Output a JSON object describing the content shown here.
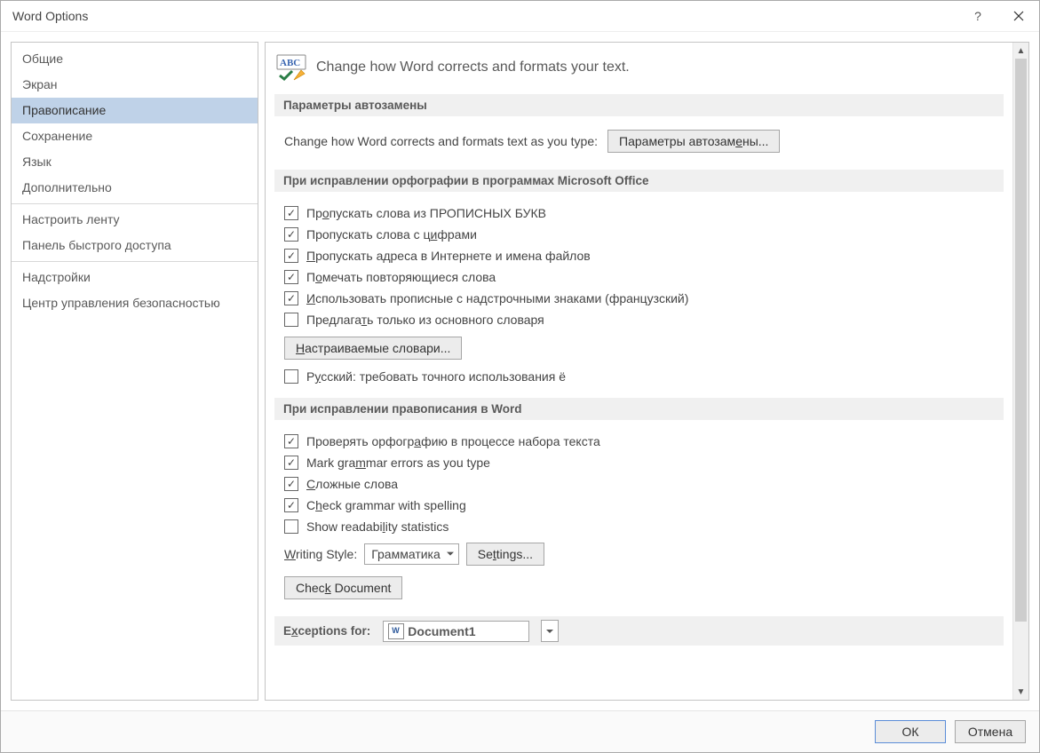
{
  "window": {
    "title": "Word Options"
  },
  "sidebar": {
    "items": [
      {
        "label": "Общие"
      },
      {
        "label": "Экран"
      },
      {
        "label": "Правописание",
        "selected": true
      },
      {
        "label": "Сохранение"
      },
      {
        "label": "Язык"
      },
      {
        "label": "Дополнительно"
      }
    ],
    "items2": [
      {
        "label": "Настроить ленту"
      },
      {
        "label": "Панель быстрого доступа"
      }
    ],
    "items3": [
      {
        "label": "Надстройки"
      },
      {
        "label": "Центр управления безопасностью"
      }
    ]
  },
  "header": {
    "text": "Change how Word corrects and formats your text."
  },
  "section1": {
    "title": "Параметры автозамены",
    "lead": "Change how Word corrects and formats text as you type:",
    "button": "Параметры автозамены..."
  },
  "section2": {
    "title": "При исправлении орфографии в программах Microsoft Office",
    "checks": [
      {
        "checked": true,
        "label": "Пропускать слова из ПРОПИСНЫХ БУКВ"
      },
      {
        "checked": true,
        "label": "Пропускать слова с цифрами"
      },
      {
        "checked": true,
        "label": "Пропускать адреса в Интернете и имена файлов"
      },
      {
        "checked": true,
        "label": "Помечать повторяющиеся слова"
      },
      {
        "checked": true,
        "label": "Использовать прописные с надстрочными знаками (французский)"
      },
      {
        "checked": false,
        "label": "Предлагать только из основного словаря"
      }
    ],
    "dict_button": "Настраиваемые словари...",
    "extra": {
      "checked": false,
      "label": "Русский: требовать точного использования ё"
    }
  },
  "section3": {
    "title": "При исправлении правописания в Word",
    "checks": [
      {
        "checked": true,
        "label": "Проверять орфографию в процессе набора текста"
      },
      {
        "checked": true,
        "label": "Mark grammar errors as you type"
      },
      {
        "checked": true,
        "label": "Сложные слова"
      },
      {
        "checked": true,
        "label": "Check grammar with spelling"
      },
      {
        "checked": false,
        "label": "Show readability statistics"
      }
    ],
    "writing_style_label": "Writing Style:",
    "writing_style_value": "Грамматика",
    "settings_button": "Settings...",
    "check_doc_button": "Check Document"
  },
  "section4": {
    "title": "Exceptions for:",
    "doc_value": "Document1"
  },
  "footer": {
    "ok": "ОК",
    "cancel": "Отмена"
  }
}
